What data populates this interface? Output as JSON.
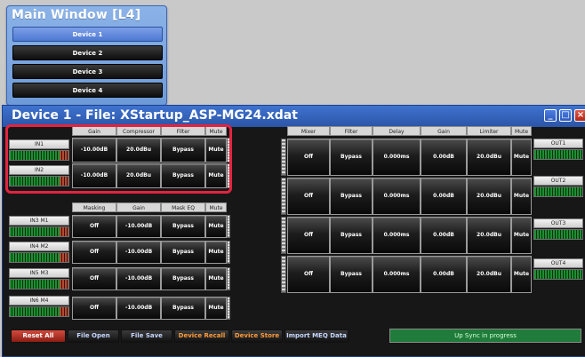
{
  "main_window": {
    "title": "Main Window [L4]",
    "devices": [
      "Device 1",
      "Device 2",
      "Device 3",
      "Device 4"
    ],
    "active_device_index": 0
  },
  "device_window": {
    "title": "Device 1  -  File: XStartup_ASP-MG24.xdat"
  },
  "inputs_top": {
    "headers": [
      "Gain",
      "Compressor",
      "Filter",
      "Mute"
    ],
    "rows": [
      {
        "label": "IN1",
        "gain": "-10.00dB",
        "compressor": "20.0dBu",
        "filter": "Bypass",
        "mute": "Mute"
      },
      {
        "label": "IN2",
        "gain": "-10.00dB",
        "compressor": "20.0dBu",
        "filter": "Bypass",
        "mute": "Mute"
      }
    ]
  },
  "inputs_mic": {
    "headers": [
      "Masking",
      "Gain",
      "Mask EQ",
      "Mute"
    ],
    "rows": [
      {
        "label": "IN3 M1",
        "masking": "Off",
        "gain": "-10.00dB",
        "mask_eq": "Bypass",
        "mute": "Mute"
      },
      {
        "label": "IN4 M2",
        "masking": "Off",
        "gain": "-10.00dB",
        "mask_eq": "Bypass",
        "mute": "Mute"
      },
      {
        "label": "IN5 M3",
        "masking": "Off",
        "gain": "-10.00dB",
        "mask_eq": "Bypass",
        "mute": "Mute"
      },
      {
        "label": "IN6 M4",
        "masking": "Off",
        "gain": "-10.00dB",
        "mask_eq": "Bypass",
        "mute": "Mute"
      }
    ]
  },
  "outputs": {
    "headers": [
      "Mixer",
      "Filter",
      "Delay",
      "Gain",
      "Limiter",
      "Mute"
    ],
    "rows": [
      {
        "label": "OUT1",
        "mixer": "Off",
        "filter": "Bypass",
        "delay": "0.000ms",
        "gain": "0.00dB",
        "limiter": "20.0dBu",
        "mute": "Mute"
      },
      {
        "label": "OUT2",
        "mixer": "Off",
        "filter": "Bypass",
        "delay": "0.000ms",
        "gain": "0.00dB",
        "limiter": "20.0dBu",
        "mute": "Mute"
      },
      {
        "label": "OUT3",
        "mixer": "Off",
        "filter": "Bypass",
        "delay": "0.000ms",
        "gain": "0.00dB",
        "limiter": "20.0dBu",
        "mute": "Mute"
      },
      {
        "label": "OUT4",
        "mixer": "Off",
        "filter": "Bypass",
        "delay": "0.000ms",
        "gain": "0.00dB",
        "limiter": "20.0dBu",
        "mute": "Mute"
      }
    ]
  },
  "footer": {
    "buttons": [
      "Reset All",
      "File Open",
      "File Save",
      "Device Recall",
      "Device Store",
      "Import MEQ Data"
    ],
    "status": "Up Sync in progress"
  }
}
